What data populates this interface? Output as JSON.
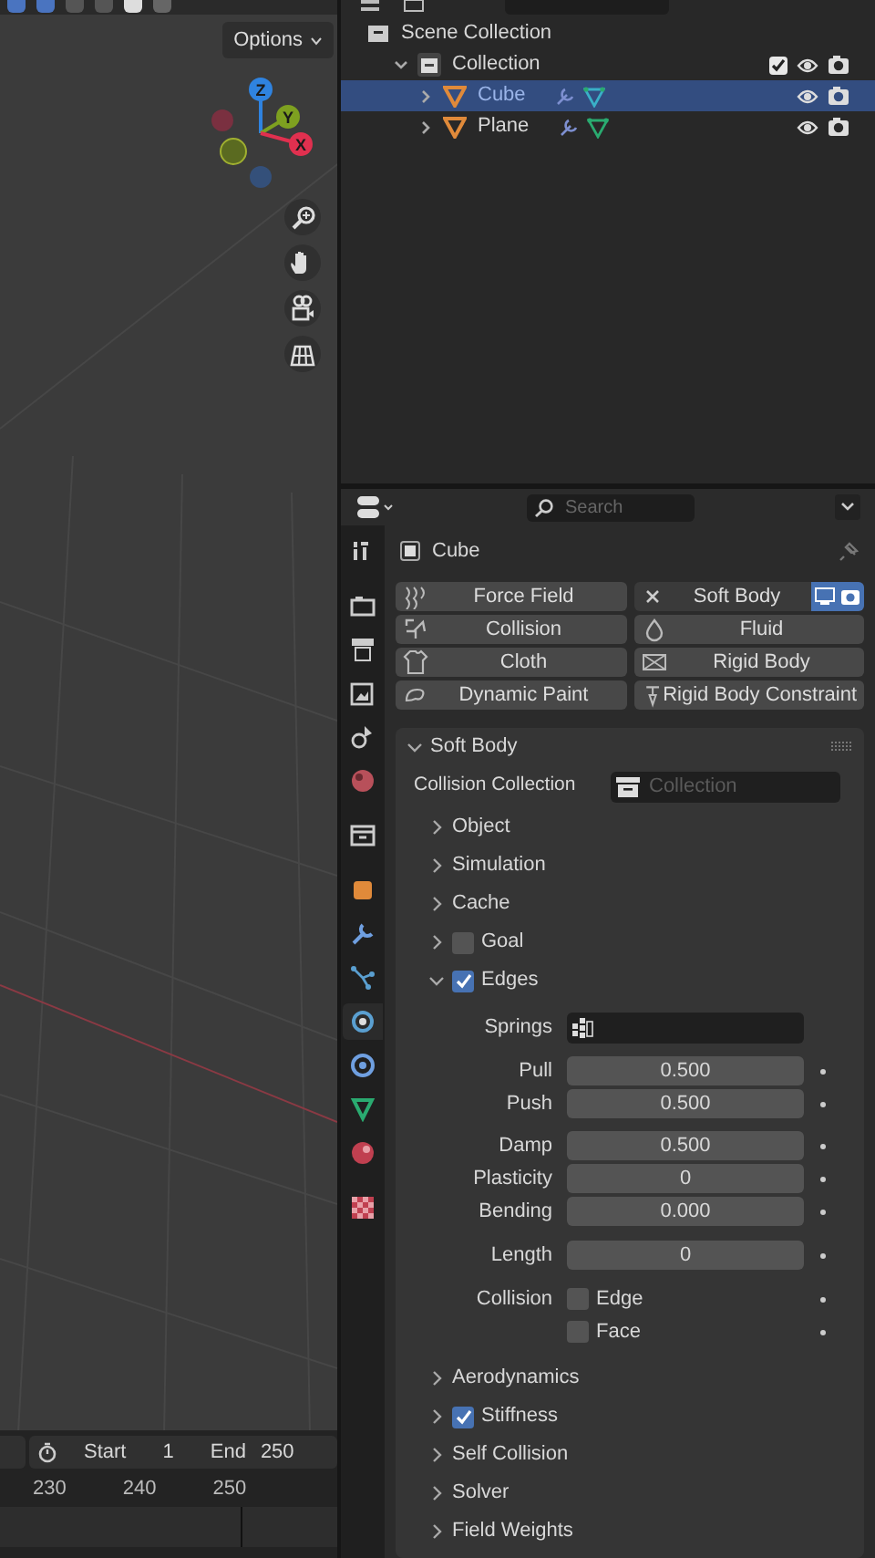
{
  "viewport": {
    "options_label": "Options",
    "gizmo_axes": [
      {
        "label": "Z",
        "color": "#2f83e0"
      },
      {
        "label": "Y",
        "color": "#7ea020"
      },
      {
        "label": "X",
        "color": "#e0304f"
      }
    ]
  },
  "timeline": {
    "start_label": "Start",
    "start": "1",
    "end_label": "End",
    "end": "250",
    "ticks": [
      "230",
      "240",
      "250"
    ]
  },
  "outliner": {
    "items": [
      {
        "label": "Scene Collection",
        "kind": "scene",
        "children": [
          {
            "label": "Collection",
            "kind": "collection",
            "expanded": true,
            "checked": true,
            "children": [
              {
                "label": "Cube",
                "kind": "object",
                "selected": true,
                "expanded": false
              },
              {
                "label": "Plane",
                "kind": "object",
                "selected": false,
                "expanded": false
              }
            ]
          }
        ]
      }
    ]
  },
  "properties": {
    "search_placeholder": "Search",
    "object_name": "Cube",
    "tabs": [
      {
        "kind": "tool",
        "selected": false
      },
      {
        "kind": "render",
        "selected": false
      },
      {
        "kind": "output",
        "selected": false
      },
      {
        "kind": "view",
        "selected": false
      },
      {
        "kind": "scene",
        "selected": false
      },
      {
        "kind": "world",
        "selected": false
      },
      {
        "kind": "collection",
        "selected": false
      },
      {
        "kind": "object",
        "selected": false
      },
      {
        "kind": "modifier",
        "selected": false
      },
      {
        "kind": "particles",
        "selected": false
      },
      {
        "kind": "physics",
        "selected": true
      },
      {
        "kind": "constraint",
        "selected": false
      },
      {
        "kind": "data",
        "selected": false
      },
      {
        "kind": "material",
        "selected": false
      },
      {
        "kind": "texture",
        "selected": false
      }
    ],
    "physics_buttons": [
      {
        "label": "Force Field",
        "enabled": false
      },
      {
        "label": "Soft Body",
        "enabled": true
      },
      {
        "label": "Collision",
        "enabled": false
      },
      {
        "label": "Fluid",
        "enabled": false
      },
      {
        "label": "Cloth",
        "enabled": false
      },
      {
        "label": "Rigid Body",
        "enabled": false
      },
      {
        "label": "Dynamic Paint",
        "enabled": false
      },
      {
        "label": "Rigid Body Constraint",
        "enabled": false
      }
    ],
    "panel": {
      "title": "Soft Body",
      "expanded": true,
      "collision_collection_label": "Collision Collection",
      "collision_collection_placeholder": "Collection",
      "subpanels": [
        {
          "label": "Object",
          "expanded": false
        },
        {
          "label": "Simulation",
          "expanded": false
        },
        {
          "label": "Cache",
          "expanded": false
        },
        {
          "label": "Goal",
          "expanded": false,
          "checked": false
        },
        {
          "label": "Edges",
          "expanded": true,
          "checked": true
        }
      ],
      "springs_label": "Springs",
      "fields": [
        {
          "label": "Pull",
          "value": "0.500"
        },
        {
          "label": "Push",
          "value": "0.500"
        },
        {
          "label": "Damp",
          "value": "0.500"
        },
        {
          "label": "Plasticity",
          "value": "0"
        },
        {
          "label": "Bending",
          "value": "0.000"
        },
        {
          "label": "Length",
          "value": "0"
        }
      ],
      "collision_label": "Collision",
      "collision_options": [
        {
          "label": "Edge",
          "checked": false
        },
        {
          "label": "Face",
          "checked": false
        }
      ],
      "more_subpanels": [
        {
          "label": "Aerodynamics",
          "expanded": false
        },
        {
          "label": "Stiffness",
          "expanded": false,
          "checked": true
        },
        {
          "label": "Self Collision",
          "expanded": false
        },
        {
          "label": "Solver",
          "expanded": false
        },
        {
          "label": "Field Weights",
          "expanded": false
        }
      ]
    }
  }
}
